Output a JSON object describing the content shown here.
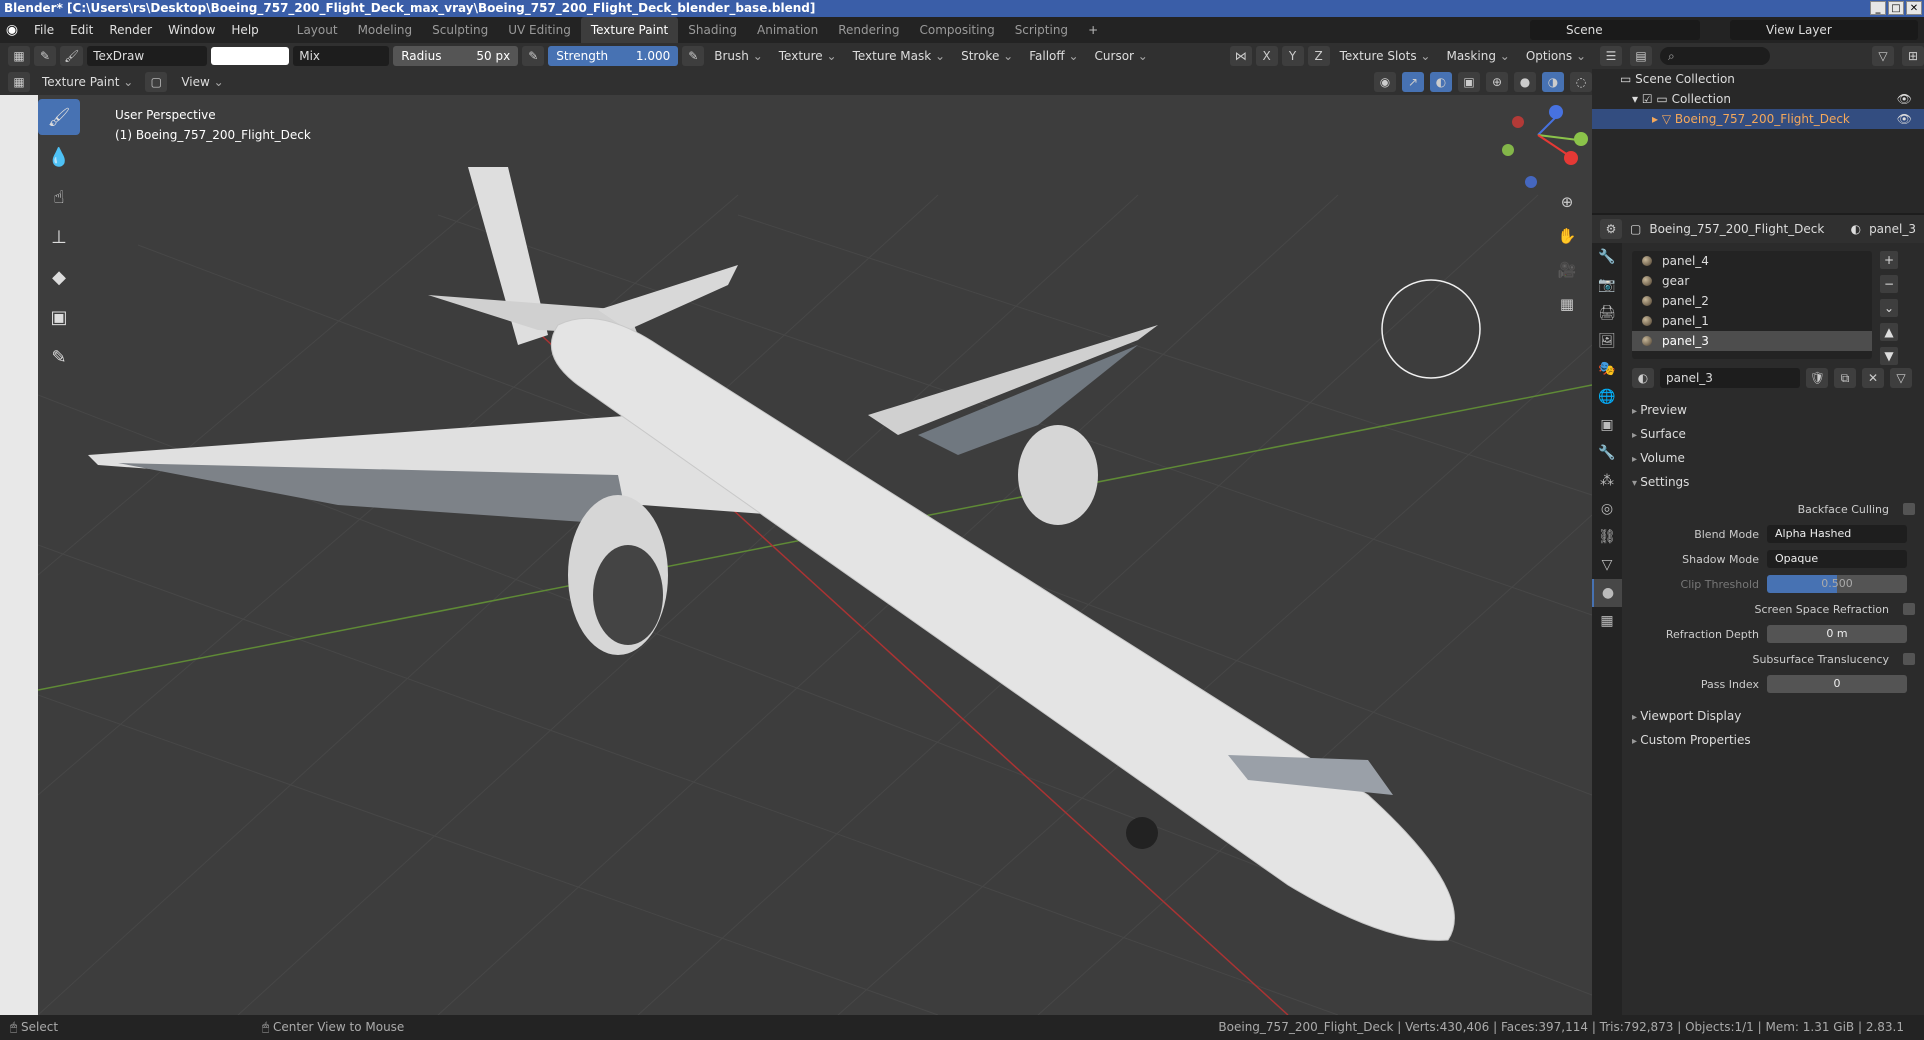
{
  "title": "Blender* [C:\\Users\\rs\\Desktop\\Boeing_757_200_Flight_Deck_max_vray\\Boeing_757_200_Flight_Deck_blender_base.blend]",
  "menu": [
    "File",
    "Edit",
    "Render",
    "Window",
    "Help"
  ],
  "workspaces": [
    "Layout",
    "Modeling",
    "Sculpting",
    "UV Editing",
    "Texture Paint",
    "Shading",
    "Animation",
    "Rendering",
    "Compositing",
    "Scripting",
    "+"
  ],
  "active_workspace": "Texture Paint",
  "scene": "Scene",
  "view_layer": "View Layer",
  "tool_header": {
    "brush_name": "TexDraw",
    "blend": "Mix",
    "radius_label": "Radius",
    "radius_value": "50 px",
    "strength_label": "Strength",
    "strength_value": "1.000",
    "menus": [
      "Brush",
      "Texture",
      "Texture Mask",
      "Stroke",
      "Falloff",
      "Cursor"
    ],
    "axes": [
      "X",
      "Y",
      "Z"
    ],
    "right_menus": [
      "Texture Slots",
      "Masking",
      "Options"
    ]
  },
  "header2": {
    "mode": "Texture Paint",
    "view": "View"
  },
  "viewport": {
    "perspective": "User Perspective",
    "object": "(1) Boeing_757_200_Flight_Deck"
  },
  "outliner": {
    "root": "Scene Collection",
    "collection": "Collection",
    "object": "Boeing_757_200_Flight_Deck"
  },
  "properties": {
    "object": "Boeing_757_200_Flight_Deck",
    "material_top": "panel_3",
    "materials": [
      "panel_4",
      "gear",
      "panel_2",
      "panel_1",
      "panel_3"
    ],
    "selected_material": "panel_3",
    "sections": [
      "Preview",
      "Surface",
      "Volume",
      "Settings"
    ],
    "settings": {
      "backface_culling": "Backface Culling",
      "blend_mode_label": "Blend Mode",
      "blend_mode": "Alpha Hashed",
      "shadow_mode_label": "Shadow Mode",
      "shadow_mode": "Opaque",
      "clip_threshold_label": "Clip Threshold",
      "clip_threshold": "0.500",
      "ssr": "Screen Space Refraction",
      "refraction_depth_label": "Refraction Depth",
      "refraction_depth": "0 m",
      "subsurface": "Subsurface Translucency",
      "pass_index_label": "Pass Index",
      "pass_index": "0"
    },
    "more_sections": [
      "Viewport Display",
      "Custom Properties"
    ]
  },
  "status": {
    "select": "Select",
    "center": "Center View to Mouse",
    "stats": "Boeing_757_200_Flight_Deck | Verts:430,406 | Faces:397,114 | Tris:792,873 | Objects:1/1 | Mem: 1.31 GiB | 2.83.1"
  }
}
